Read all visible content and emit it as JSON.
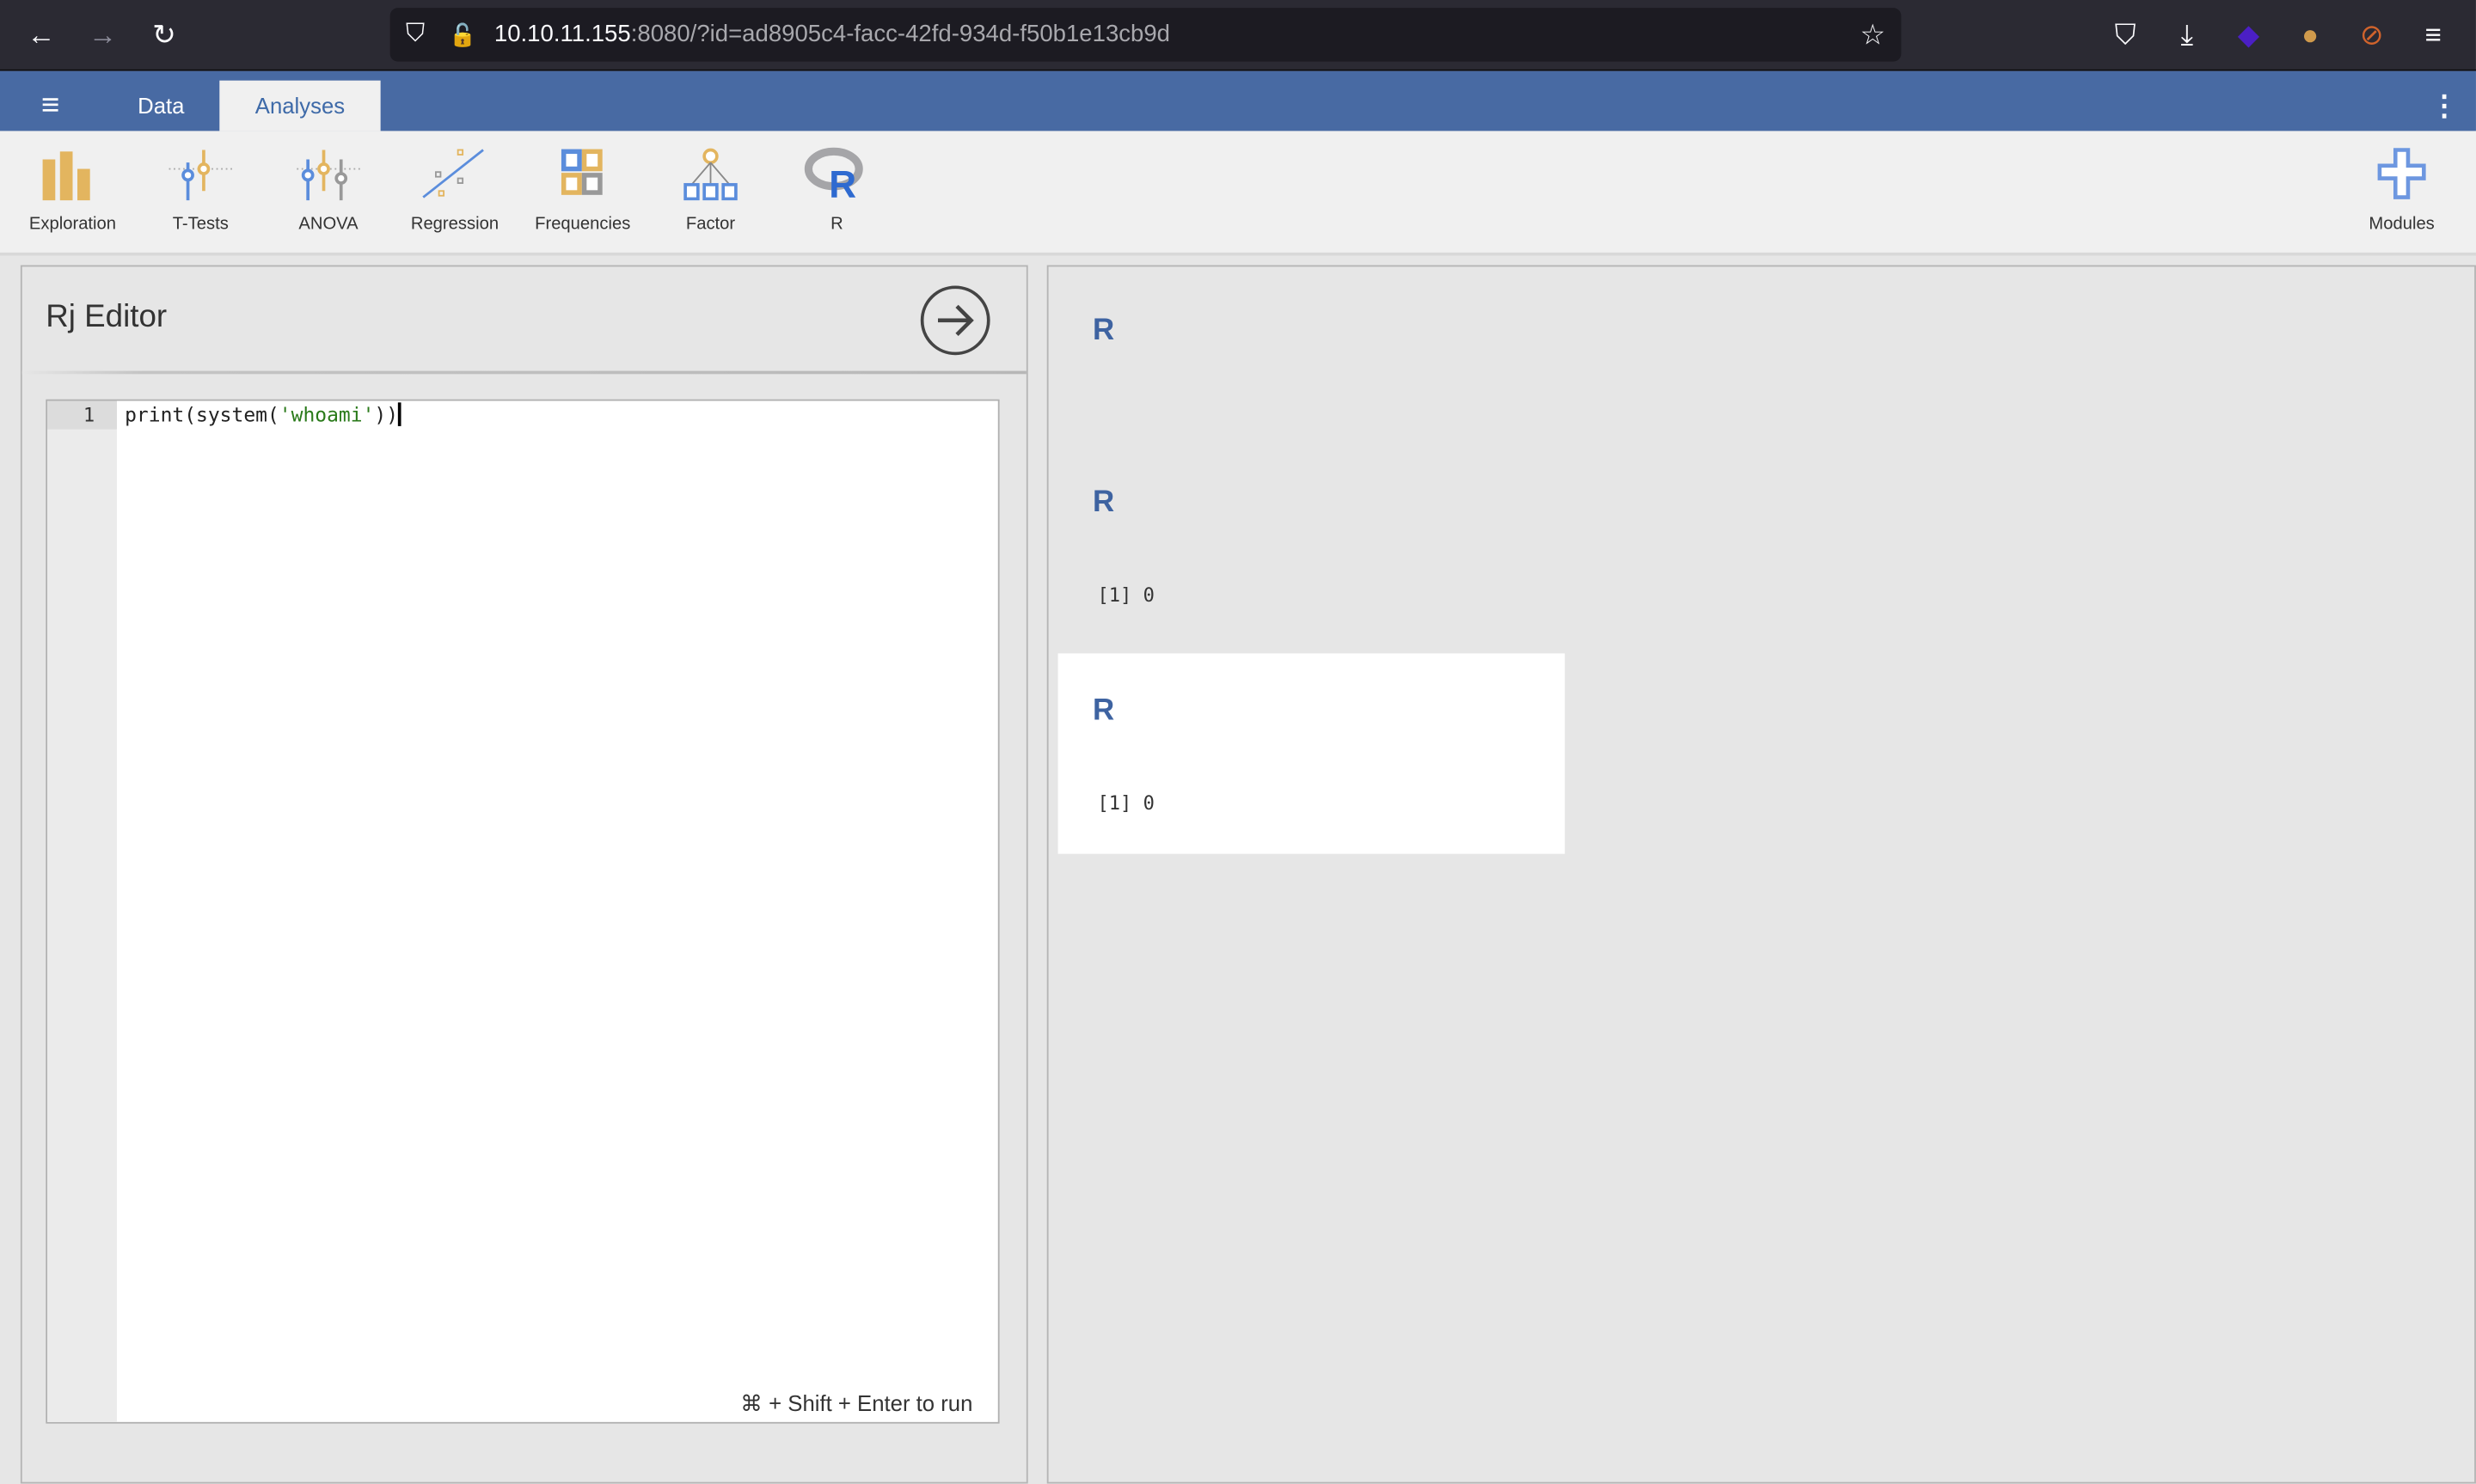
{
  "browser": {
    "url_host": "10.10.11.155",
    "url_rest": ":8080/?id=ad8905c4-facc-42fd-934d-f50b1e13cb9d",
    "icons": [
      "back-icon",
      "forward-icon",
      "reload-icon",
      "shield-icon",
      "insecure-lock-icon",
      "star-icon",
      "pocket-icon",
      "download-icon",
      "extension-icon",
      "cookie-icon",
      "fox-blocked-icon",
      "menu-icon"
    ]
  },
  "app": {
    "tabs": [
      {
        "label": "Data"
      },
      {
        "label": "Analyses",
        "active": true
      }
    ],
    "ribbon": [
      {
        "label": "Exploration",
        "icon": "exploration-icon"
      },
      {
        "label": "T-Tests",
        "icon": "ttests-icon"
      },
      {
        "label": "ANOVA",
        "icon": "anova-icon"
      },
      {
        "label": "Regression",
        "icon": "regression-icon"
      },
      {
        "label": "Frequencies",
        "icon": "frequencies-icon"
      },
      {
        "label": "Factor",
        "icon": "factor-icon"
      },
      {
        "label": "R",
        "icon": "r-logo-icon"
      }
    ],
    "modules_label": "Modules",
    "accent": "#486aa3"
  },
  "editor": {
    "title": "Rj Editor",
    "line_number": "1",
    "code_pre": "print(system(",
    "code_str": "'whoami'",
    "code_post": "))",
    "hint": "⌘ + Shift + Enter to run"
  },
  "results": [
    {
      "heading": "R",
      "output": ""
    },
    {
      "heading": "R",
      "output": "[1] 0"
    },
    {
      "heading": "R",
      "output": "[1] 0",
      "selected": true
    }
  ]
}
